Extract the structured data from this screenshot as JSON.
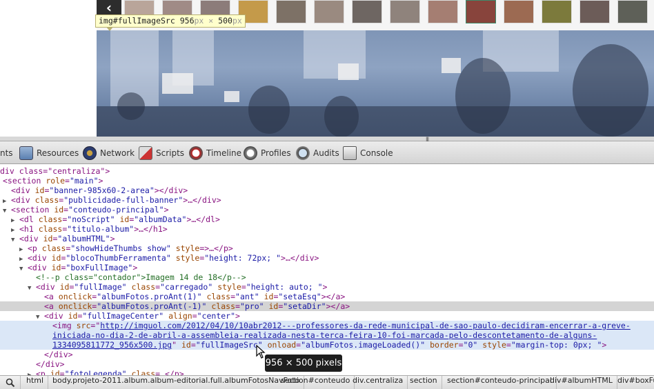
{
  "page": {
    "prev_arrow": "‹",
    "tooltip": {
      "selector": "img#fullImageSrc",
      "width": "956",
      "height": "500",
      "unit": "px",
      "times": "×"
    },
    "resizer_grip": "|||"
  },
  "toolbar": {
    "items": [
      {
        "label": "nts",
        "icon": "elements-icon"
      },
      {
        "label": "Resources",
        "icon": "resources-icon"
      },
      {
        "label": "Network",
        "icon": "network-icon"
      },
      {
        "label": "Scripts",
        "icon": "scripts-icon"
      },
      {
        "label": "Timeline",
        "icon": "timeline-icon"
      },
      {
        "label": "Profiles",
        "icon": "profiles-icon"
      },
      {
        "label": "Audits",
        "icon": "audits-icon"
      },
      {
        "label": "Console",
        "icon": "console-icon"
      }
    ]
  },
  "dom": {
    "l0": "div class=\"centraliza\">",
    "l1_tag": "<section ",
    "l1_an": "role",
    "l1_av": "\"main\"",
    "l2_tag": "<div ",
    "l2_an": "id",
    "l2_av": "\"banner-985x60-2-area\"",
    "l2_end": "></div>",
    "l3_tag": "<div ",
    "l3_an": "class",
    "l3_av": "\"publicidade-full-banner\"",
    "l3_end": ">…</div>",
    "l4_tag": "<section ",
    "l4_an": "id",
    "l4_av": "\"conteudo-principal\"",
    "l5_tag": "<dl ",
    "l5_an1": "class",
    "l5_av1": "\"noScript\"",
    "l5_an2": "id",
    "l5_av2": "\"albumData\"",
    "l5_end": ">…</dl>",
    "l6_tag": "<h1 ",
    "l6_an": "class",
    "l6_av": "\"titulo-album\"",
    "l6_end": ">…</h1>",
    "l7_tag": "<div ",
    "l7_an": "id",
    "l7_av": "\"albumHTML\"",
    "l8_tag": "<p ",
    "l8_an1": "class",
    "l8_av1": "\"showHideThumbs show\"",
    "l8_an2": "style",
    "l8_end": ">…</p>",
    "l9_tag": "<div ",
    "l9_an1": "id",
    "l9_av1": "\"blocoThumbFerramenta\"",
    "l9_an2": "style",
    "l9_av2": "\"height: 72px; \"",
    "l9_end": ">…</div>",
    "l10_tag": "<div ",
    "l10_an": "id",
    "l10_av": "\"boxFullImage\"",
    "l11": "<!--p class=\"contador\">Imagem 14 de 18</p-->",
    "l12_tag": "<div ",
    "l12_an1": "id",
    "l12_av1": "\"fullImage\"",
    "l12_an2": "class",
    "l12_av2": "\"carregado\"",
    "l12_an3": "style",
    "l12_av3": "\"height: auto; \"",
    "l13_tag": "<a ",
    "l13_an1": "onclick",
    "l13_av1": "\"albumFotos.proAnt(1)\"",
    "l13_an2": "class",
    "l13_av2": "\"ant\"",
    "l13_an3": "id",
    "l13_av3": "\"setaEsq\"",
    "l13_end": "></a>",
    "l14_tag": "<a ",
    "l14_an1": "onclick",
    "l14_av1": "\"albumFotos.proAnt(-1)\"",
    "l14_an2": "class",
    "l14_av2": "\"pro\"",
    "l14_an3": "id",
    "l14_av3": "\"setaDir\"",
    "l14_end": "></a>",
    "l15_tag": "<div ",
    "l15_an1": "id",
    "l15_av1": "\"fullImageCenter\"",
    "l15_an2": "align",
    "l15_av2": "\"center\"",
    "l16_tag": "<img ",
    "l16_an": "src",
    "l16_link1": "http://imguol.com/2012/04/10/10abr2012---professores-da-rede-municipal-de-sao-paulo-decidiram-encerrar-a-greve-",
    "l17_link2": "iniciada-no-dia-2-de-abril-a-assembleia-realizada-nesta-terca-feira-10-foi-marcada-pelo-descontetamento-de-alguns-",
    "l18_link3": "1334095811772_956x500.jpg",
    "l18_an1": "id",
    "l18_av1": "\"fullImageSrc\"",
    "l18_an2": "onload",
    "l18_av2": "\"albumFotos.imageLoaded()\"",
    "l18_an3": "border",
    "l18_av3": "\"0\"",
    "l18_an4": "style",
    "l18_av4": "\"margin-top: 0px; \"",
    "l19": "</div>",
    "l20": "</div>",
    "l21_tag": "<p ",
    "l21_an": "id",
    "l21_av": "\"fotoLegenda\"",
    "l21_an2": "class",
    "l21_end": "…</p>"
  },
  "size_tooltip": "956 × 500 pixels",
  "breadcrumbs": [
    "html",
    "body.projeto-2011.album.album-editorial.full.albumFotosNavFoto",
    "section#conteudo",
    "div.centraliza",
    "section",
    "section#conteudo-principal",
    "div#albumHTML",
    "div#boxFul"
  ],
  "colors": {
    "selected_row": "#d4d4d4",
    "hover_row": "#dbe7f7",
    "tag": "#881280",
    "attr_name": "#994500",
    "attr_value": "#1a1aa6",
    "comment": "#236e25"
  }
}
